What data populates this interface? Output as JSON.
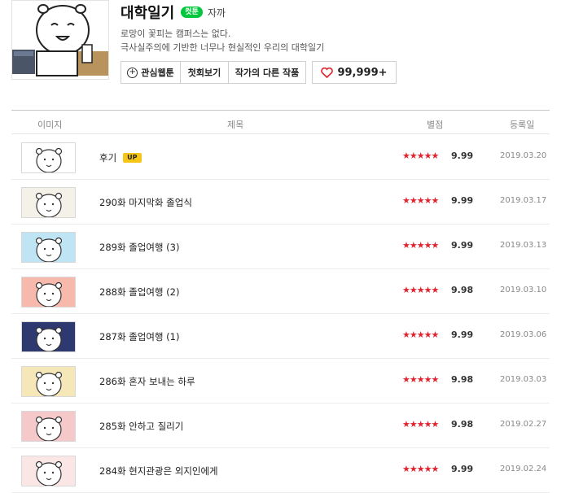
{
  "webtoon": {
    "title": "대학일기",
    "genre_badge": "컷툰",
    "author": "자까",
    "description": [
      "로망이 꽃피는 캠퍼스는 없다.",
      "극사실주의에 기반한 너무나 현실적인 우리의 대학일기"
    ],
    "buttons": {
      "favorite": "관심웹툰",
      "first_episode": "첫회보기",
      "author_other": "작가의 다른 작품",
      "likes": "99,999+"
    }
  },
  "table": {
    "headers": {
      "image": "이미지",
      "title": "제목",
      "rating": "별점",
      "date": "등록일"
    },
    "stars": "★★★★★",
    "rows": [
      {
        "title": "후기",
        "badge": "UP",
        "score": "9.99",
        "date": "2019.03.20",
        "thumb_bg": "#ffffff"
      },
      {
        "title": "290화 마지막화 졸업식",
        "badge": "",
        "score": "9.99",
        "date": "2019.03.17",
        "thumb_bg": "#f4f1e8"
      },
      {
        "title": "289화 졸업여행 (3)",
        "badge": "",
        "score": "9.99",
        "date": "2019.03.13",
        "thumb_bg": "#bfe4f4"
      },
      {
        "title": "288화 졸업여행 (2)",
        "badge": "",
        "score": "9.98",
        "date": "2019.03.10",
        "thumb_bg": "#f8b9ad"
      },
      {
        "title": "287화 졸업여행 (1)",
        "badge": "",
        "score": "9.99",
        "date": "2019.03.06",
        "thumb_bg": "#2e3970"
      },
      {
        "title": "286화 혼자 보내는 하루",
        "badge": "",
        "score": "9.98",
        "date": "2019.03.03",
        "thumb_bg": "#f6e7b8"
      },
      {
        "title": "285화 안하고 질리기",
        "badge": "",
        "score": "9.98",
        "date": "2019.02.27",
        "thumb_bg": "#f5c9c9"
      },
      {
        "title": "284화 현지관광은 외지인에게",
        "badge": "",
        "score": "9.99",
        "date": "2019.02.24",
        "thumb_bg": "#fbe6e6"
      }
    ]
  },
  "colors": {
    "accent_green": "#00c73c",
    "star_red": "#e1232e",
    "up_yellow": "#f5c518"
  }
}
